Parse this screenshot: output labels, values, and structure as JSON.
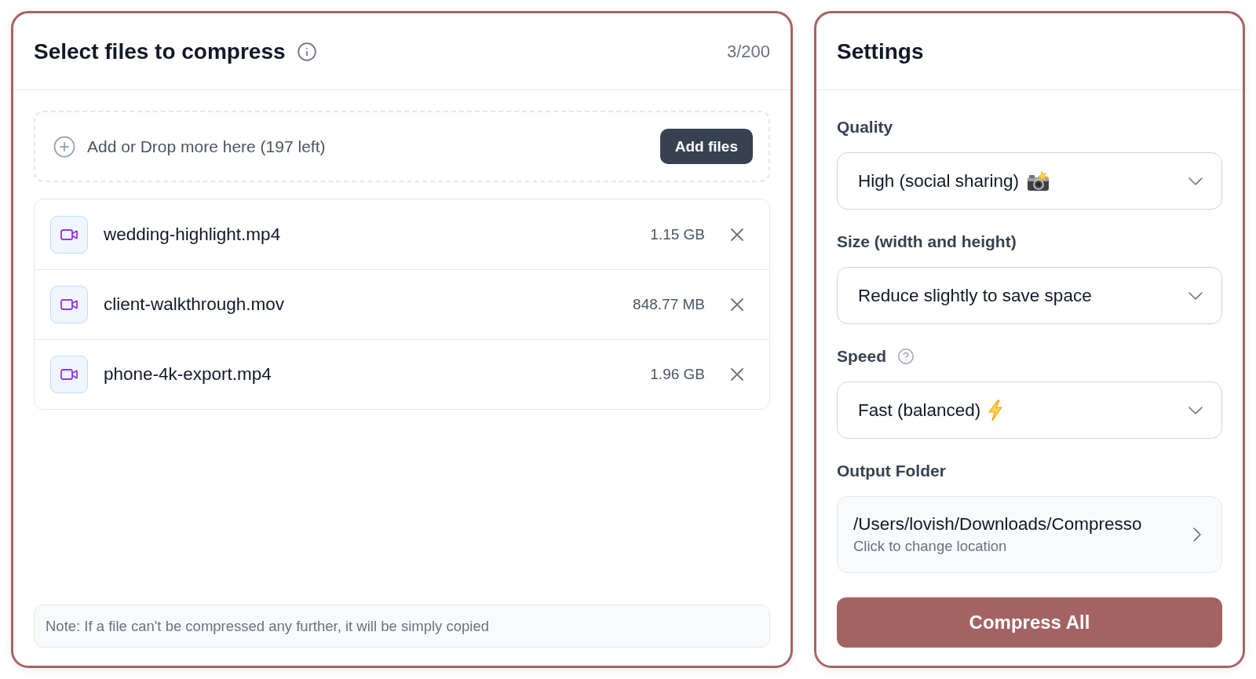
{
  "files_panel": {
    "title": "Select files to compress",
    "count": "3/200",
    "drop_zone": {
      "text": "Add or Drop more here (197 left)",
      "button": "Add files"
    },
    "files": [
      {
        "name": "wedding-highlight.mp4",
        "size": "1.15 GB"
      },
      {
        "name": "client-walkthrough.mov",
        "size": "848.77 MB"
      },
      {
        "name": "phone-4k-export.mp4",
        "size": "1.96 GB"
      }
    ],
    "note": "Note: If a file can't be compressed any further, it will be simply copied"
  },
  "settings_panel": {
    "title": "Settings",
    "quality": {
      "label": "Quality",
      "value": "High (social sharing)"
    },
    "size": {
      "label": "Size (width and height)",
      "value": "Reduce slightly to save space"
    },
    "speed": {
      "label": "Speed",
      "value": "Fast (balanced)"
    },
    "output_folder": {
      "label": "Output Folder",
      "path": "/Users/lovish/Downloads/Compresso",
      "hint": "Click to change location"
    },
    "button": "Compress All"
  }
}
